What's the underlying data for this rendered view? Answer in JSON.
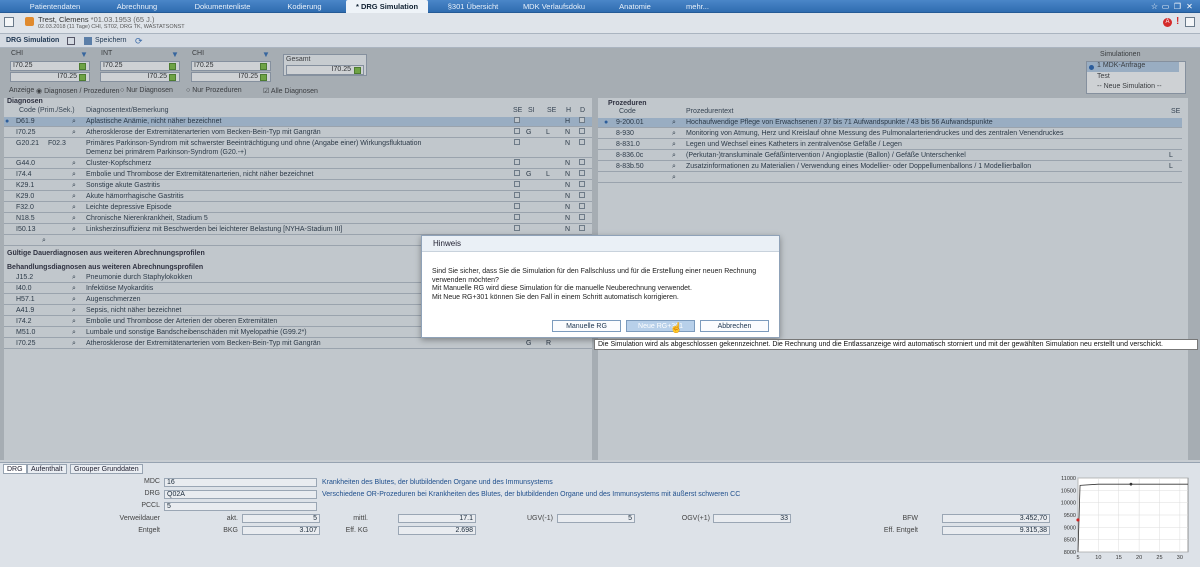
{
  "top_tabs": [
    "Patientendaten",
    "Abrechnung",
    "Dokumentenliste",
    "Kodierung",
    "* DRG Simulation",
    "§301 Übersicht",
    "MDK Verlaufsdoku",
    "Anatomie",
    "mehr..."
  ],
  "patient": {
    "name": "Trest, Clemens",
    "birth": "*01.03.1953 (65 J.)",
    "line2": "02.03.2018 (11 Tage) CHI, ST02, DRG TK, WASTATSONST"
  },
  "simbar": {
    "title": "DRG Simulation",
    "save": "Speichern"
  },
  "groups": [
    {
      "label": "CHI",
      "v1": "I70.25",
      "v2": "I70.25"
    },
    {
      "label": "INT",
      "v1": "I70.25",
      "v2": "I70.25"
    },
    {
      "label": "CHI",
      "v1": "I70.25",
      "v2": "I70.25"
    }
  ],
  "gesamt": {
    "label": "Gesamt",
    "value": "I70.25"
  },
  "anzeige": {
    "label": "Anzeige",
    "options": [
      "Diagnosen / Prozeduren",
      "Nur Diagnosen",
      "Nur Prozeduren"
    ],
    "alle": "Alle Diagnosen"
  },
  "simulationen": {
    "title": "Simulationen",
    "items": [
      "1 MDK-Anfrage",
      "Test",
      "-- Neue Simulation --"
    ]
  },
  "diag": {
    "title": "Diagnosen",
    "headers": {
      "code": "Code (Prim./Sek.)",
      "text": "Diagnosentext/Bemerkung",
      "se": "SE",
      "si": "SI",
      "se2": "SE",
      "h": "H",
      "d": "D"
    },
    "rows": [
      {
        "code": "D61.9",
        "sec": "",
        "text": "Aplastische Anämie, nicht näher bezeichnet",
        "si": "",
        "se": "",
        "h": "H"
      },
      {
        "code": "I70.25",
        "sec": "",
        "text": "Atherosklerose der Extremitätenarterien vom Becken-Bein-Typ mit Gangrän",
        "si": "G",
        "se": "L",
        "h": "N"
      },
      {
        "code": "G20.21",
        "sec": "F02.3",
        "text": "Primäres Parkinson-Syndrom mit schwerster Beeinträchtigung und ohne (Angabe einer) Wirkungsfluktuation",
        "text2": "Demenz bei primärem Parkinson-Syndrom (G20.-+)",
        "si": "",
        "se": "",
        "h": "N"
      },
      {
        "code": "G44.0",
        "sec": "",
        "text": "Cluster-Kopfschmerz",
        "si": "",
        "se": "",
        "h": "N"
      },
      {
        "code": "I74.4",
        "sec": "",
        "text": "Embolie und Thrombose der Extremitätenarterien, nicht näher bezeichnet",
        "si": "G",
        "se": "L",
        "h": "N"
      },
      {
        "code": "K29.1",
        "sec": "",
        "text": "Sonstige akute Gastritis",
        "si": "",
        "se": "",
        "h": "N"
      },
      {
        "code": "K29.0",
        "sec": "",
        "text": "Akute hämorrhagische Gastritis",
        "si": "",
        "se": "",
        "h": "N"
      },
      {
        "code": "F32.0",
        "sec": "",
        "text": "Leichte depressive Episode",
        "si": "",
        "se": "",
        "h": "N"
      },
      {
        "code": "N18.5",
        "sec": "",
        "text": "Chronische Nierenkrankheit, Stadium 5",
        "si": "",
        "se": "",
        "h": "N"
      },
      {
        "code": "I50.13",
        "sec": "",
        "text": "Linksherzinsuffizienz mit Beschwerden bei leichterer Belastung [NYHA-Stadium III]",
        "si": "",
        "se": "",
        "h": "N"
      }
    ],
    "section1": "Gültige Dauerdiagnosen aus weiteren Abrechnungsprofilen",
    "section2": "Behandlungsdiagnosen aus weiteren Abrechnungsprofilen",
    "rows2": [
      {
        "code": "J15.2",
        "text": "Pneumonie durch Staphylokokken"
      },
      {
        "code": "I40.0",
        "text": "Infektiöse Myokarditis"
      },
      {
        "code": "H57.1",
        "text": "Augenschmerzen"
      },
      {
        "code": "A41.9",
        "text": "Sepsis, nicht näher bezeichnet"
      },
      {
        "code": "I74.2",
        "text": "Embolie und Thrombose der Arterien der oberen Extremitäten"
      },
      {
        "code": "M51.0",
        "text": "Lumbale und sonstige Bandscheibenschäden mit Myelopathie (G99.2*)"
      },
      {
        "code": "I70.25",
        "text": "Atherosklerose der Extremitätenarterien vom Becken-Bein-Typ mit Gangrän",
        "si": "G",
        "se": "R"
      }
    ]
  },
  "proz": {
    "title": "Prozeduren",
    "headers": {
      "code": "Code",
      "text": "Prozedurentext",
      "se": "SE"
    },
    "rows": [
      {
        "code": "9-200.01",
        "text": "Hochaufwendige Pflege von Erwachsenen / 37 bis 71 Aufwandspunkte / 43 bis 56 Aufwandspunkte",
        "se": ""
      },
      {
        "code": "8-930",
        "text": "Monitoring von Atmung, Herz und Kreislauf ohne Messung des Pulmonalarteriendruckes und des zentralen Venendruckes",
        "se": ""
      },
      {
        "code": "8-831.0",
        "text": "Legen und Wechsel eines Katheters in zentralvenöse Gefäße / Legen",
        "se": ""
      },
      {
        "code": "8-836.0c",
        "text": "(Perkutan-)transluminale Gefäßintervention / Angioplastie (Ballon) / Gefäße Unterschenkel",
        "se": "L"
      },
      {
        "code": "8-83b.50",
        "text": "Zusatzinformationen zu Materialien / Verwendung eines Modellier- oder Doppellumenballons / 1 Modellierballon",
        "se": "L"
      }
    ]
  },
  "dialog": {
    "title": "Hinweis",
    "lines": [
      "Sind Sie sicher, dass Sie die Simulation für den Fallschluss und für die Erstellung einer neuen Rechnung",
      "verwenden möchten?",
      "Mit Manuelle RG wird diese Simulation für die manuelle Neuberechnung verwendet.",
      "Mit Neue RG+301 können Sie den Fall in einem Schritt automatisch korrigieren."
    ],
    "btn_manual": "Manuelle RG",
    "btn_new": "Neue RG+301",
    "btn_cancel": "Abbrechen"
  },
  "tooltip": "Die Simulation wird als abgeschlossen gekennzeichnet. Die Rechnung und die Entlassanzeige wird automatisch storniert und mit der gewählten Simulation neu erstellt und verschickt.",
  "bottom": {
    "tabs": [
      "DRG",
      "Aufenthalt",
      "Grouper Grunddaten"
    ],
    "mdc_label": "MDC",
    "mdc": "16",
    "mdc_text": "Krankheiten des Blutes, der blutbildenden Organe und des Immunsystems",
    "drg_label": "DRG",
    "drg": "Q02A",
    "drg_text": "Verschiedene OR-Prozeduren bei Krankheiten des Blutes, der blutbildenden Organe und des Immunsystems mit äußerst schweren CC",
    "pccl_label": "PCCL",
    "pccl": "5",
    "vwd_label": "Verweildauer",
    "akt_label": "akt.",
    "akt": "5",
    "mittl_label": "mittl.",
    "mittl": "17.1",
    "ugv_label": "UGV(-1)",
    "ugv": "5",
    "ogv_label": "OGV(+1)",
    "ogv": "33",
    "bfw_label": "BFW",
    "bfw": "3.452,70",
    "entgelt_label": "Entgelt",
    "bkg_label": "BKG",
    "bkg": "3.107",
    "effkg_label": "Eff. KG",
    "effkg": "2.698",
    "effent_label": "Eff. Entgelt",
    "effent": "9.315,38"
  },
  "chart_data": {
    "type": "line",
    "y_ticks": [
      "11000",
      "10500",
      "10000",
      "9500",
      "9000",
      "8500",
      "8000"
    ],
    "x_ticks": [
      "5",
      "10",
      "15",
      "20",
      "25",
      "30"
    ],
    "ylim": [
      8000,
      11000
    ],
    "xlim": [
      5,
      32
    ],
    "series": [
      {
        "points": [
          [
            5,
            8000
          ],
          [
            5.5,
            10700
          ],
          [
            10,
            10750
          ],
          [
            32,
            10750
          ]
        ]
      }
    ],
    "markers": [
      [
        5,
        9300
      ],
      [
        18,
        10750
      ]
    ]
  }
}
